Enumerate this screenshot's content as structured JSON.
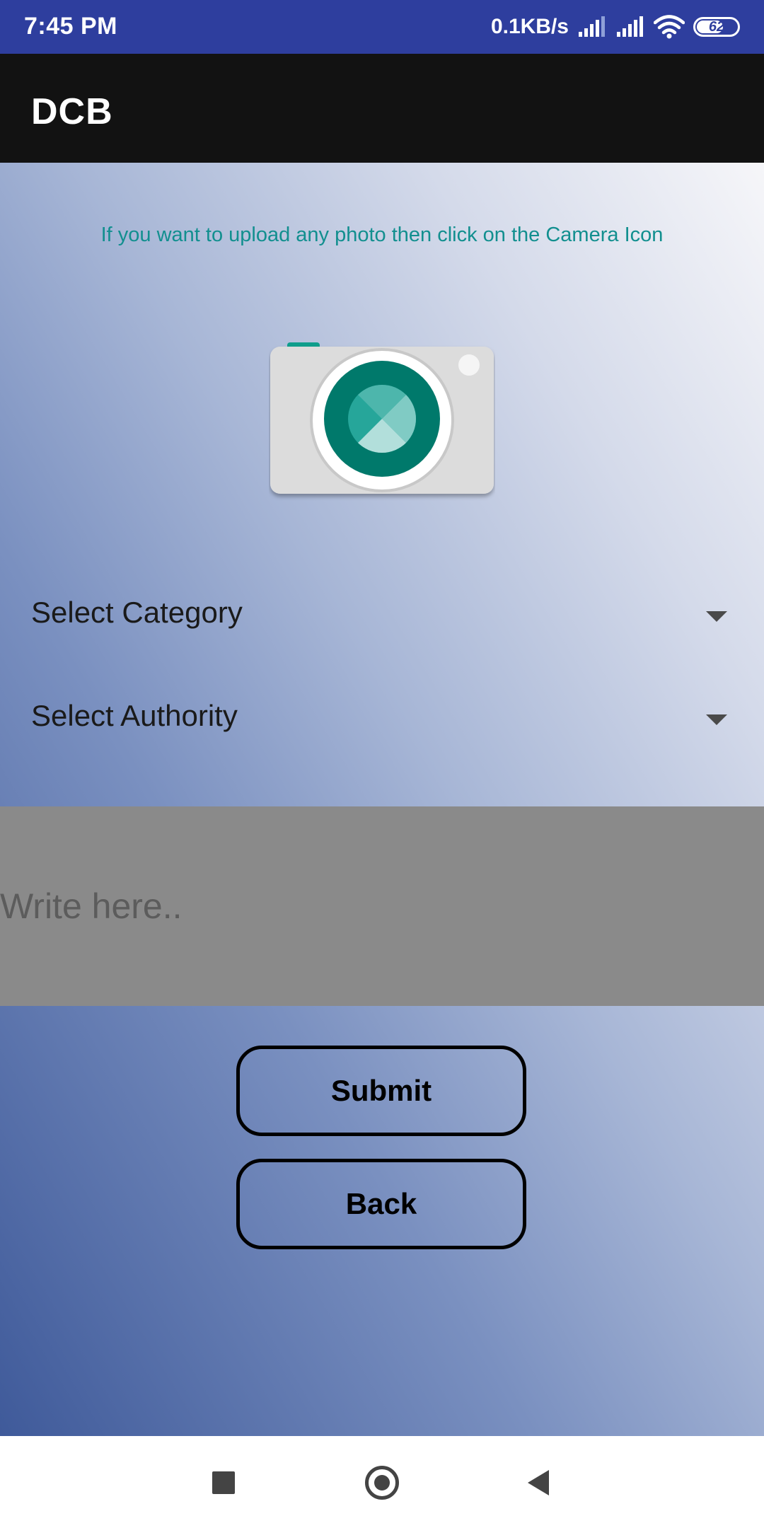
{
  "status_bar": {
    "time": "7:45 PM",
    "network_speed": "0.1KB/s",
    "battery_level": "62",
    "icons": [
      "signal-icon",
      "signal-icon",
      "wifi-icon",
      "battery-icon"
    ]
  },
  "app_bar": {
    "title": "DCB"
  },
  "main": {
    "upload_hint": "If you want to upload any photo then click on the Camera Icon",
    "camera_icon": "camera-icon",
    "category_spinner": {
      "label": "Select Category",
      "icon": "dropdown-arrow-icon"
    },
    "authority_spinner": {
      "label": "Select Authority",
      "icon": "dropdown-arrow-icon"
    },
    "write_field": {
      "placeholder": "Write here..",
      "value": ""
    },
    "submit_label": "Submit",
    "back_label": "Back"
  },
  "nav_bar": {
    "icons": [
      "recents-icon",
      "home-icon",
      "back-icon"
    ]
  },
  "colors": {
    "status_bar": "#2e3e9e",
    "app_bar": "#121212",
    "hint_text": "#128f8f",
    "camera_lens": "#00796b",
    "write_area": "#8a8a8a"
  }
}
